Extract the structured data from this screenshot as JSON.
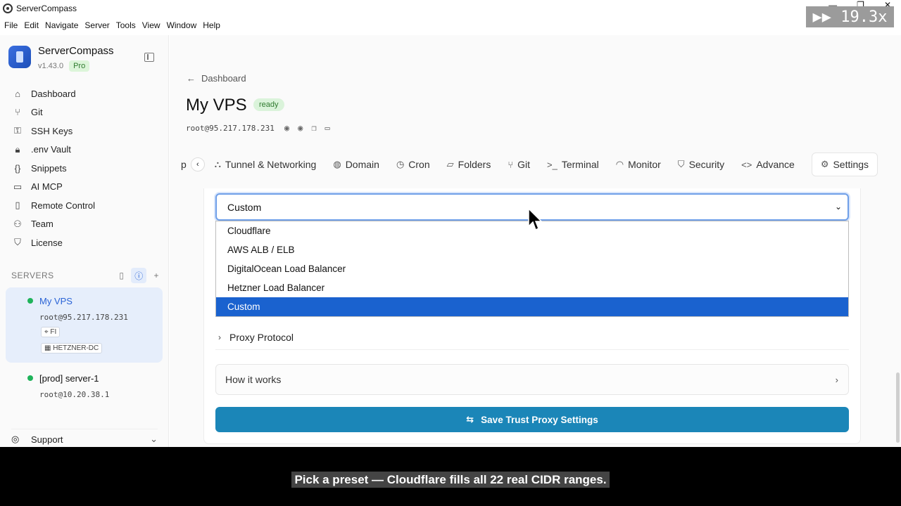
{
  "window": {
    "title": "ServerCompass",
    "minimize": "—",
    "maximize": "❐",
    "close": "✕"
  },
  "overlay": {
    "speed": "▶▶ 19.3x"
  },
  "menu": [
    "File",
    "Edit",
    "Navigate",
    "Server",
    "Tools",
    "View",
    "Window",
    "Help"
  ],
  "sidebar": {
    "brand_name": "ServerCompass",
    "version": "v1.43.0",
    "plan": "Pro",
    "nav": [
      {
        "label": "Dashboard",
        "icon": "home-icon",
        "glyph": "⌂"
      },
      {
        "label": "Git",
        "icon": "git-icon",
        "glyph": "⑂"
      },
      {
        "label": "SSH Keys",
        "icon": "key-icon",
        "glyph": "⚿"
      },
      {
        "label": ".env Vault",
        "icon": "lock-icon",
        "glyph": "🔒︎"
      },
      {
        "label": "Snippets",
        "icon": "braces-icon",
        "glyph": "{}"
      },
      {
        "label": "AI MCP",
        "icon": "terminal-icon",
        "glyph": "▭"
      },
      {
        "label": "Remote Control",
        "icon": "phone-icon",
        "glyph": "▯"
      },
      {
        "label": "Team",
        "icon": "user-icon",
        "glyph": "⚇"
      },
      {
        "label": "License",
        "icon": "shield-icon",
        "glyph": "⛉"
      }
    ],
    "servers_heading": "SERVERS",
    "servers": [
      {
        "name": "My VPS",
        "address": "root@95.217.178.231",
        "location": "FI",
        "provider": "HETZNER-DC"
      },
      {
        "name": "[prod] server-1",
        "address": "root@10.20.38.1"
      }
    ],
    "support_label": "Support"
  },
  "main": {
    "breadcrumb": "Dashboard",
    "title": "My VPS",
    "status": "ready",
    "ssh": "root@95.217.178.231",
    "tabs": [
      {
        "label": "p",
        "icon": ""
      },
      {
        "label": "Tunnel & Networking",
        "icon": "⛬"
      },
      {
        "label": "Domain",
        "icon": "◍"
      },
      {
        "label": "Cron",
        "icon": "◷"
      },
      {
        "label": "Folders",
        "icon": "▱"
      },
      {
        "label": "Git",
        "icon": "⑂"
      },
      {
        "label": "Terminal",
        "icon": ">_"
      },
      {
        "label": "Monitor",
        "icon": "◠"
      },
      {
        "label": "Security",
        "icon": "⛉"
      },
      {
        "label": "Advance",
        "icon": "<>"
      },
      {
        "label": "Settings",
        "icon": "⚙"
      }
    ],
    "preset_select": {
      "value": "Custom",
      "options": [
        "Cloudflare",
        "AWS ALB / ELB",
        "DigitalOcean Load Balancer",
        "Hetzner Load Balancer",
        "Custom"
      ],
      "selected_index": 4
    },
    "proxy_protocol_label": "Proxy Protocol",
    "how_it_works_label": "How it works",
    "save_button_label": "Save Trust Proxy Settings"
  },
  "caption": "Pick a preset — Cloudflare fills all 22 real CIDR ranges.",
  "colors": {
    "accent": "#1b86b8",
    "selected_option": "#1a62cf",
    "status_green": "#1fb35a"
  }
}
